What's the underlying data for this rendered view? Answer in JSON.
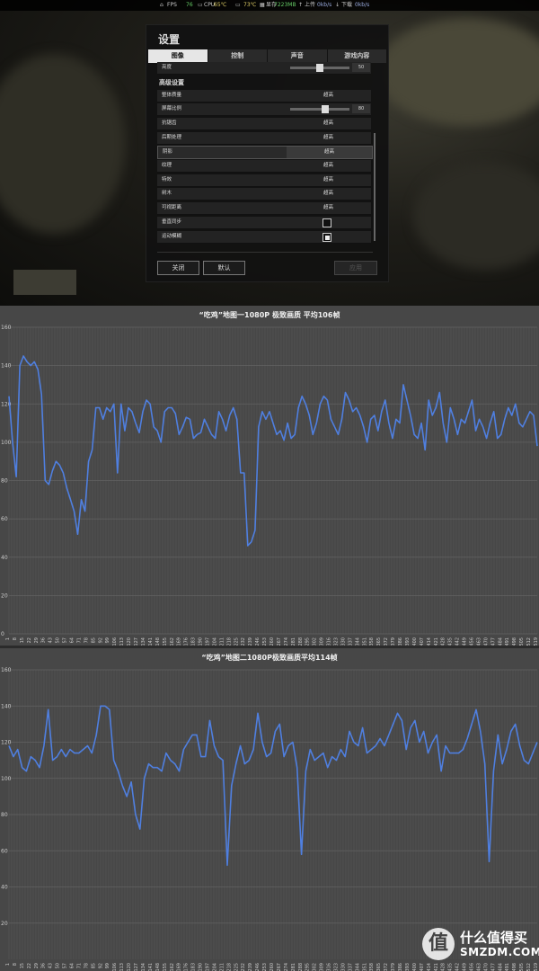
{
  "osd": {
    "fps_label": "FPS",
    "fps_value": "76",
    "cpu_label": "CPU",
    "cpu_temp": "65℃",
    "gpu_temp": "73℃",
    "vram_label": "显存",
    "vram_value": "7223MB",
    "upload_label": "上传",
    "upload_value": "0kb/s",
    "download_label": "下载",
    "download_value": "0kb/s"
  },
  "settings": {
    "title": "设置",
    "tabs": [
      "图像",
      "控制",
      "声音",
      "游戏内容"
    ],
    "brightness_label": "亮度",
    "brightness_value": "50",
    "brightness_level": 0.5,
    "section_title": "高级设置",
    "rows": [
      {
        "label": "整体质量",
        "value": "超高"
      },
      {
        "label": "屏幕比例",
        "value": "80"
      },
      {
        "label": "抗锯齿",
        "value": "超高"
      },
      {
        "label": "后期处理",
        "value": "超高"
      },
      {
        "label": "阴影",
        "value": "超高"
      },
      {
        "label": "纹理",
        "value": "超高"
      },
      {
        "label": "特效",
        "value": "超高"
      },
      {
        "label": "树木",
        "value": "超高"
      },
      {
        "label": "可视距离",
        "value": "超高"
      },
      {
        "label": "垂直同步",
        "value": ""
      },
      {
        "label": "运动模糊",
        "value": ""
      }
    ],
    "screen_scale_level": 0.6,
    "vsync_checked": false,
    "motion_blur_checked": true,
    "buttons": {
      "close": "关闭",
      "default": "默认",
      "apply": "应用"
    }
  },
  "watermark": {
    "line1": "什么值得买",
    "line2": "SMZDM.COM",
    "logo": "值"
  },
  "chart_data": [
    {
      "type": "line",
      "title": "“吃鸡”地图一1080P 极致画质 平均106帧",
      "ylim": [
        0,
        160
      ],
      "yticks": [
        0,
        20,
        40,
        60,
        80,
        100,
        120,
        140,
        160
      ],
      "xlabels_every": 7,
      "x_start": 1,
      "x_end": 519,
      "color": "#4f7fe0",
      "values": [
        124,
        100,
        82,
        140,
        145,
        142,
        140,
        142,
        138,
        125,
        80,
        78,
        85,
        90,
        88,
        84,
        76,
        70,
        64,
        52,
        70,
        64,
        90,
        96,
        118,
        118,
        112,
        118,
        116,
        120,
        84,
        120,
        106,
        118,
        116,
        110,
        105,
        116,
        122,
        120,
        108,
        106,
        100,
        116,
        118,
        118,
        115,
        104,
        108,
        113,
        112,
        102,
        104,
        105,
        112,
        108,
        104,
        102,
        116,
        112,
        106,
        114,
        118,
        112,
        84,
        84,
        46,
        48,
        54,
        108,
        116,
        112,
        116,
        110,
        104,
        106,
        101,
        110,
        102,
        104,
        118,
        124,
        120,
        114,
        104,
        110,
        120,
        124,
        122,
        112,
        108,
        104,
        112,
        126,
        122,
        116,
        118,
        114,
        108,
        100,
        112,
        114,
        106,
        116,
        122,
        110,
        102,
        112,
        110,
        130,
        122,
        114,
        104,
        102,
        110,
        96,
        122,
        114,
        118,
        126,
        110,
        100,
        118,
        112,
        104,
        112,
        110,
        116,
        122,
        106,
        112,
        108,
        102,
        110,
        116,
        102,
        104,
        112,
        118,
        114,
        120,
        110,
        108,
        112,
        116,
        114,
        98
      ]
    },
    {
      "type": "line",
      "title": "“吃鸡”地图二1080P极致画质平均114帧",
      "ylim": [
        0,
        160
      ],
      "yticks": [
        20,
        40,
        60,
        80,
        100,
        120,
        140,
        160
      ],
      "xlabels_every": 7,
      "x_start": 1,
      "x_end": 519,
      "color": "#4f7fe0",
      "values": [
        118,
        112,
        116,
        106,
        104,
        112,
        110,
        106,
        118,
        138,
        110,
        112,
        116,
        112,
        116,
        114,
        114,
        116,
        118,
        114,
        124,
        140,
        140,
        138,
        110,
        104,
        96,
        90,
        98,
        80,
        72,
        100,
        108,
        106,
        106,
        104,
        114,
        110,
        108,
        104,
        116,
        120,
        124,
        124,
        112,
        112,
        132,
        118,
        112,
        110,
        52,
        96,
        108,
        118,
        108,
        110,
        116,
        136,
        120,
        112,
        114,
        126,
        130,
        112,
        118,
        120,
        106,
        58,
        104,
        116,
        110,
        112,
        114,
        106,
        112,
        110,
        116,
        112,
        126,
        120,
        118,
        128,
        114,
        116,
        118,
        122,
        118,
        124,
        130,
        136,
        132,
        116,
        128,
        132,
        120,
        126,
        114,
        120,
        124,
        104,
        118,
        114,
        114,
        114,
        116,
        122,
        130,
        138,
        126,
        108,
        54,
        104,
        124,
        108,
        116,
        126,
        130,
        118,
        110,
        108,
        114,
        120
      ]
    }
  ]
}
